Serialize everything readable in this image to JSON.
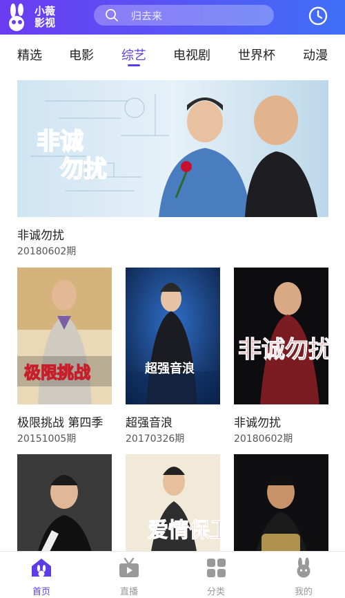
{
  "header": {
    "logo_line1": "小薇",
    "logo_line2": "影视",
    "search_placeholder": "归去来",
    "history_icon": "clock-icon"
  },
  "tabs": [
    {
      "label": "精选",
      "active": false
    },
    {
      "label": "电影",
      "active": false
    },
    {
      "label": "综艺",
      "active": true
    },
    {
      "label": "电视剧",
      "active": false
    },
    {
      "label": "世界杯",
      "active": false
    },
    {
      "label": "动漫",
      "active": false
    }
  ],
  "featured": {
    "title": "非诚勿扰",
    "subtitle": "20180602期",
    "poster_text": "非诚勿扰"
  },
  "grid": [
    {
      "title": "极限挑战 第四季",
      "subtitle": "20151005期",
      "poster_text": "极限挑战"
    },
    {
      "title": "超强音浪",
      "subtitle": "20170326期",
      "poster_text": "超强音浪"
    },
    {
      "title": "非诚勿扰",
      "subtitle": "20180602期",
      "poster_text": "非诚勿扰"
    },
    {
      "title": "",
      "subtitle": "",
      "poster_text": ""
    },
    {
      "title": "",
      "subtitle": "",
      "poster_text": "爱情保卫战"
    },
    {
      "title": "",
      "subtitle": "",
      "poster_text": ""
    }
  ],
  "bottom_nav": [
    {
      "label": "首页",
      "icon": "home-icon",
      "active": true
    },
    {
      "label": "直播",
      "icon": "tv-icon",
      "active": false
    },
    {
      "label": "分类",
      "icon": "grid-icon",
      "active": false
    },
    {
      "label": "我的",
      "icon": "profile-icon",
      "active": false
    }
  ],
  "colors": {
    "accent": "#5b3de8",
    "header_start": "#6a3cf0",
    "header_end": "#3f6ff6",
    "nav_inactive": "#999999"
  }
}
